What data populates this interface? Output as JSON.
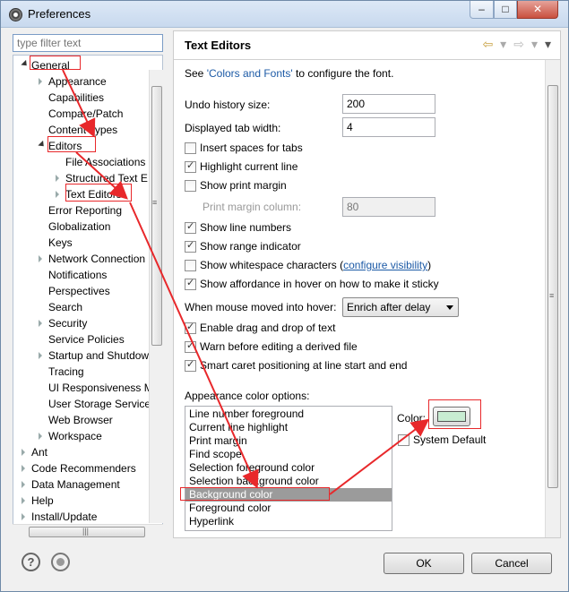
{
  "window": {
    "title": "Preferences",
    "minimize": "–",
    "maximize": "□",
    "close": "✕"
  },
  "filter": {
    "placeholder": "type filter text"
  },
  "tree": {
    "items": [
      {
        "label": "General",
        "level": 0,
        "state": "open"
      },
      {
        "label": "Appearance",
        "level": 1,
        "state": "closed"
      },
      {
        "label": "Capabilities",
        "level": 1,
        "state": "leaf"
      },
      {
        "label": "Compare/Patch",
        "level": 1,
        "state": "leaf"
      },
      {
        "label": "Content Types",
        "level": 1,
        "state": "leaf"
      },
      {
        "label": "Editors",
        "level": 1,
        "state": "open"
      },
      {
        "label": "File Associations",
        "level": 2,
        "state": "leaf"
      },
      {
        "label": "Structured Text E",
        "level": 2,
        "state": "closed"
      },
      {
        "label": "Text Editors",
        "level": 2,
        "state": "closed"
      },
      {
        "label": "Error Reporting",
        "level": 1,
        "state": "leaf"
      },
      {
        "label": "Globalization",
        "level": 1,
        "state": "leaf"
      },
      {
        "label": "Keys",
        "level": 1,
        "state": "leaf"
      },
      {
        "label": "Network Connection",
        "level": 1,
        "state": "closed"
      },
      {
        "label": "Notifications",
        "level": 1,
        "state": "leaf"
      },
      {
        "label": "Perspectives",
        "level": 1,
        "state": "leaf"
      },
      {
        "label": "Search",
        "level": 1,
        "state": "leaf"
      },
      {
        "label": "Security",
        "level": 1,
        "state": "closed"
      },
      {
        "label": "Service Policies",
        "level": 1,
        "state": "leaf"
      },
      {
        "label": "Startup and Shutdow",
        "level": 1,
        "state": "closed"
      },
      {
        "label": "Tracing",
        "level": 1,
        "state": "leaf"
      },
      {
        "label": "UI Responsiveness M",
        "level": 1,
        "state": "leaf"
      },
      {
        "label": "User Storage Service",
        "level": 1,
        "state": "leaf"
      },
      {
        "label": "Web Browser",
        "level": 1,
        "state": "leaf"
      },
      {
        "label": "Workspace",
        "level": 1,
        "state": "closed"
      },
      {
        "label": "Ant",
        "level": 0,
        "state": "closed"
      },
      {
        "label": "Code Recommenders",
        "level": 0,
        "state": "closed"
      },
      {
        "label": "Data Management",
        "level": 0,
        "state": "closed"
      },
      {
        "label": "Help",
        "level": 0,
        "state": "closed"
      },
      {
        "label": "Install/Update",
        "level": 0,
        "state": "closed"
      }
    ]
  },
  "page": {
    "title": "Text Editors",
    "see_prefix": "See ",
    "colors_link": "'Colors and Fonts'",
    "see_suffix": " to configure the font.",
    "undo_label": "Undo history size:",
    "undo_value": "200",
    "tab_label": "Displayed tab width:",
    "tab_value": "4",
    "insert_spaces": "Insert spaces for tabs",
    "highlight_line": "Highlight current line",
    "show_print_margin": "Show print margin",
    "print_margin_label": "Print margin column:",
    "print_margin_value": "80",
    "show_line_numbers": "Show line numbers",
    "show_range": "Show range indicator",
    "show_whitespace": "Show whitespace characters",
    "ws_paren_open": "(",
    "configure_visibility": "configure visibility",
    "ws_paren_close": ")",
    "show_affordance": "Show affordance in hover on how to make it sticky",
    "hover_label": "When mouse moved into hover:",
    "hover_value": "Enrich after delay",
    "drag_drop": "Enable drag and drop of text",
    "warn_derived": "Warn before editing a derived file",
    "smart_caret": "Smart caret positioning at line start and end",
    "appearance_label": "Appearance color options:",
    "color_label": "Color:",
    "color_value": "#c8ecd2",
    "system_default": "System Default",
    "color_options": [
      "Line number foreground",
      "Current line highlight",
      "Print margin",
      "Find scope",
      "Selection foreground color",
      "Selection background color",
      "Background color",
      "Foreground color",
      "Hyperlink"
    ],
    "selected_option": "Background color"
  },
  "buttons": {
    "ok": "OK",
    "cancel": "Cancel",
    "help": "?"
  },
  "annotation_color": "#e8282b"
}
